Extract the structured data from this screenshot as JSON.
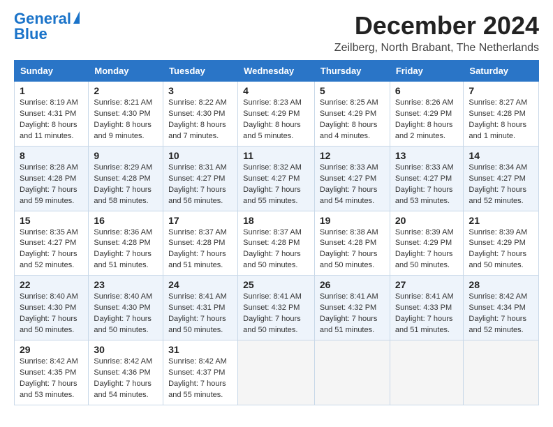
{
  "header": {
    "logo_line1": "General",
    "logo_line2": "Blue",
    "title": "December 2024",
    "subtitle": "Zeilberg, North Brabant, The Netherlands"
  },
  "columns": [
    "Sunday",
    "Monday",
    "Tuesday",
    "Wednesday",
    "Thursday",
    "Friday",
    "Saturday"
  ],
  "weeks": [
    [
      {
        "day": "1",
        "info": "Sunrise: 8:19 AM\nSunset: 4:31 PM\nDaylight: 8 hours and 11 minutes."
      },
      {
        "day": "2",
        "info": "Sunrise: 8:21 AM\nSunset: 4:30 PM\nDaylight: 8 hours and 9 minutes."
      },
      {
        "day": "3",
        "info": "Sunrise: 8:22 AM\nSunset: 4:30 PM\nDaylight: 8 hours and 7 minutes."
      },
      {
        "day": "4",
        "info": "Sunrise: 8:23 AM\nSunset: 4:29 PM\nDaylight: 8 hours and 5 minutes."
      },
      {
        "day": "5",
        "info": "Sunrise: 8:25 AM\nSunset: 4:29 PM\nDaylight: 8 hours and 4 minutes."
      },
      {
        "day": "6",
        "info": "Sunrise: 8:26 AM\nSunset: 4:29 PM\nDaylight: 8 hours and 2 minutes."
      },
      {
        "day": "7",
        "info": "Sunrise: 8:27 AM\nSunset: 4:28 PM\nDaylight: 8 hours and 1 minute."
      }
    ],
    [
      {
        "day": "8",
        "info": "Sunrise: 8:28 AM\nSunset: 4:28 PM\nDaylight: 7 hours and 59 minutes."
      },
      {
        "day": "9",
        "info": "Sunrise: 8:29 AM\nSunset: 4:28 PM\nDaylight: 7 hours and 58 minutes."
      },
      {
        "day": "10",
        "info": "Sunrise: 8:31 AM\nSunset: 4:27 PM\nDaylight: 7 hours and 56 minutes."
      },
      {
        "day": "11",
        "info": "Sunrise: 8:32 AM\nSunset: 4:27 PM\nDaylight: 7 hours and 55 minutes."
      },
      {
        "day": "12",
        "info": "Sunrise: 8:33 AM\nSunset: 4:27 PM\nDaylight: 7 hours and 54 minutes."
      },
      {
        "day": "13",
        "info": "Sunrise: 8:33 AM\nSunset: 4:27 PM\nDaylight: 7 hours and 53 minutes."
      },
      {
        "day": "14",
        "info": "Sunrise: 8:34 AM\nSunset: 4:27 PM\nDaylight: 7 hours and 52 minutes."
      }
    ],
    [
      {
        "day": "15",
        "info": "Sunrise: 8:35 AM\nSunset: 4:27 PM\nDaylight: 7 hours and 52 minutes."
      },
      {
        "day": "16",
        "info": "Sunrise: 8:36 AM\nSunset: 4:28 PM\nDaylight: 7 hours and 51 minutes."
      },
      {
        "day": "17",
        "info": "Sunrise: 8:37 AM\nSunset: 4:28 PM\nDaylight: 7 hours and 51 minutes."
      },
      {
        "day": "18",
        "info": "Sunrise: 8:37 AM\nSunset: 4:28 PM\nDaylight: 7 hours and 50 minutes."
      },
      {
        "day": "19",
        "info": "Sunrise: 8:38 AM\nSunset: 4:28 PM\nDaylight: 7 hours and 50 minutes."
      },
      {
        "day": "20",
        "info": "Sunrise: 8:39 AM\nSunset: 4:29 PM\nDaylight: 7 hours and 50 minutes."
      },
      {
        "day": "21",
        "info": "Sunrise: 8:39 AM\nSunset: 4:29 PM\nDaylight: 7 hours and 50 minutes."
      }
    ],
    [
      {
        "day": "22",
        "info": "Sunrise: 8:40 AM\nSunset: 4:30 PM\nDaylight: 7 hours and 50 minutes."
      },
      {
        "day": "23",
        "info": "Sunrise: 8:40 AM\nSunset: 4:30 PM\nDaylight: 7 hours and 50 minutes."
      },
      {
        "day": "24",
        "info": "Sunrise: 8:41 AM\nSunset: 4:31 PM\nDaylight: 7 hours and 50 minutes."
      },
      {
        "day": "25",
        "info": "Sunrise: 8:41 AM\nSunset: 4:32 PM\nDaylight: 7 hours and 50 minutes."
      },
      {
        "day": "26",
        "info": "Sunrise: 8:41 AM\nSunset: 4:32 PM\nDaylight: 7 hours and 51 minutes."
      },
      {
        "day": "27",
        "info": "Sunrise: 8:41 AM\nSunset: 4:33 PM\nDaylight: 7 hours and 51 minutes."
      },
      {
        "day": "28",
        "info": "Sunrise: 8:42 AM\nSunset: 4:34 PM\nDaylight: 7 hours and 52 minutes."
      }
    ],
    [
      {
        "day": "29",
        "info": "Sunrise: 8:42 AM\nSunset: 4:35 PM\nDaylight: 7 hours and 53 minutes."
      },
      {
        "day": "30",
        "info": "Sunrise: 8:42 AM\nSunset: 4:36 PM\nDaylight: 7 hours and 54 minutes."
      },
      {
        "day": "31",
        "info": "Sunrise: 8:42 AM\nSunset: 4:37 PM\nDaylight: 7 hours and 55 minutes."
      },
      {
        "day": "",
        "info": ""
      },
      {
        "day": "",
        "info": ""
      },
      {
        "day": "",
        "info": ""
      },
      {
        "day": "",
        "info": ""
      }
    ]
  ]
}
